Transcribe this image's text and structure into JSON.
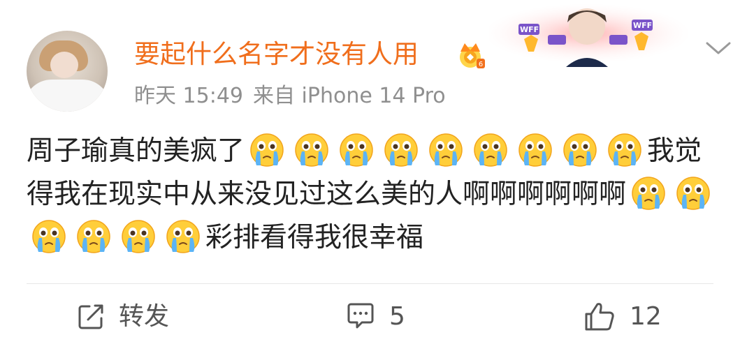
{
  "post": {
    "username": "要起什么名字才没有人用",
    "timestamp": "昨天 15:49",
    "source": "来自 iPhone 14 Pro",
    "fan_badge_text": "WFF",
    "content_part1": "周子瑜真的美疯了",
    "content_part2": "我觉得我在现实中从来没见过这么美的人啊啊啊啊啊啊",
    "content_part3": "彩排看得我很幸福",
    "emoji_group1_count": 9,
    "emoji_group2_count": 6,
    "emoji_name": "crying-face"
  },
  "actions": {
    "repost_label": "转发",
    "comment_count": "5",
    "like_count": "12"
  },
  "colors": {
    "username": "#f06e1c",
    "meta": "#8f8f8f",
    "text": "#222222",
    "divider": "#e6e6e6"
  },
  "icons": [
    "vip-crown-icon",
    "expand-chevron-icon",
    "repost-icon",
    "comment-icon",
    "like-icon"
  ]
}
